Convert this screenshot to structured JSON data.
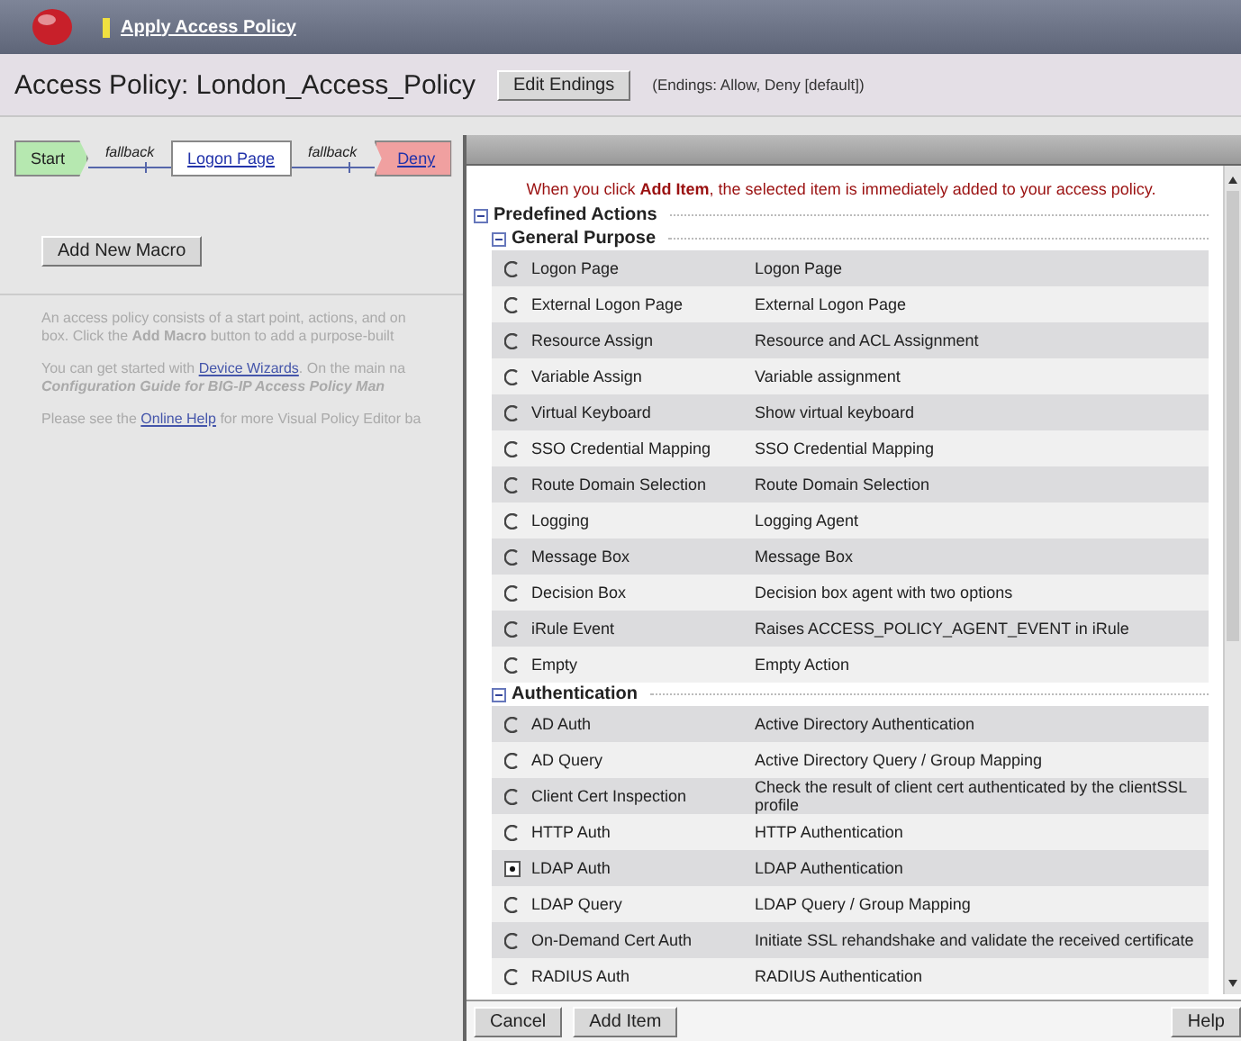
{
  "header": {
    "link": "Apply Access Policy"
  },
  "title_bar": {
    "title": "Access Policy: London_Access_Policy",
    "button": "Edit Endings",
    "endings": "(Endings: Allow, Deny [default])"
  },
  "flow": [
    {
      "kind": "start",
      "label": "Start"
    },
    {
      "kind": "branch",
      "label": "fallback"
    },
    {
      "kind": "action",
      "label": "Logon Page"
    },
    {
      "kind": "branch",
      "label": "fallback"
    },
    {
      "kind": "ending",
      "label": "Deny"
    }
  ],
  "left_panel": {
    "button": "Add New Macro",
    "lines": [
      {
        "kind": "text",
        "text": "An access policy consists of a start point, actions, and on"
      },
      {
        "kind": "text",
        "text": "box. Click the **Add Macro** button to add a purpose-built"
      },
      {
        "kind": "gap"
      },
      {
        "kind": "link",
        "before": "You can get started with ",
        "link": "Device Wizards",
        "after": ". On the main na"
      },
      {
        "kind": "italic",
        "text": "Configuration Guide for BIG-IP Access Policy Man"
      },
      {
        "kind": "gap"
      },
      {
        "kind": "link",
        "before": "Please see the ",
        "link": "Online Help",
        "after": " for more Visual Policy Editor ba"
      }
    ]
  },
  "dialog": {
    "message": "When you click **Add Item**, the selected item is immediately added to your access policy.",
    "tree": {
      "label": "Predefined Actions",
      "expanded": true,
      "children": [
        {
          "label": "General Purpose",
          "expanded": true,
          "items": [
            {
              "name": "Logon Page",
              "description": "Logon Page",
              "selected": false
            },
            {
              "name": "External Logon Page",
              "description": "External Logon Page",
              "selected": false
            },
            {
              "name": "Resource Assign",
              "description": "Resource and ACL Assignment",
              "selected": false
            },
            {
              "name": "Variable Assign",
              "description": "Variable assignment",
              "selected": false
            },
            {
              "name": "Virtual Keyboard",
              "description": "Show virtual keyboard",
              "selected": false
            },
            {
              "name": "SSO Credential Mapping",
              "description": "SSO Credential Mapping",
              "selected": false
            },
            {
              "name": "Route Domain Selection",
              "description": "Route Domain Selection",
              "selected": false
            },
            {
              "name": "Logging",
              "description": "Logging Agent",
              "selected": false
            },
            {
              "name": "Message Box",
              "description": "Message Box",
              "selected": false
            },
            {
              "name": "Decision Box",
              "description": "Decision box agent with two options",
              "selected": false
            },
            {
              "name": "iRule Event",
              "description": "Raises ACCESS_POLICY_AGENT_EVENT in iRule",
              "selected": false
            },
            {
              "name": "Empty",
              "description": "Empty Action",
              "selected": false
            }
          ]
        },
        {
          "label": "Authentication",
          "expanded": true,
          "items": [
            {
              "name": "AD Auth",
              "description": "Active Directory Authentication",
              "selected": false
            },
            {
              "name": "AD Query",
              "description": "Active Directory Query / Group Mapping",
              "selected": false
            },
            {
              "name": "Client Cert Inspection",
              "description": "Check the result of client cert authenticated by the clientSSL profile",
              "selected": false
            },
            {
              "name": "HTTP Auth",
              "description": "HTTP Authentication",
              "selected": false
            },
            {
              "name": "LDAP Auth",
              "description": "LDAP Authentication",
              "selected": true
            },
            {
              "name": "LDAP Query",
              "description": "LDAP Query / Group Mapping",
              "selected": false
            },
            {
              "name": "On-Demand Cert Auth",
              "description": "Initiate SSL rehandshake and validate the received certificate",
              "selected": false
            },
            {
              "name": "RADIUS Auth",
              "description": "RADIUS Authentication",
              "selected": false
            }
          ]
        }
      ]
    },
    "buttons": [
      "Cancel",
      "Add Item"
    ],
    "help": "Help"
  }
}
